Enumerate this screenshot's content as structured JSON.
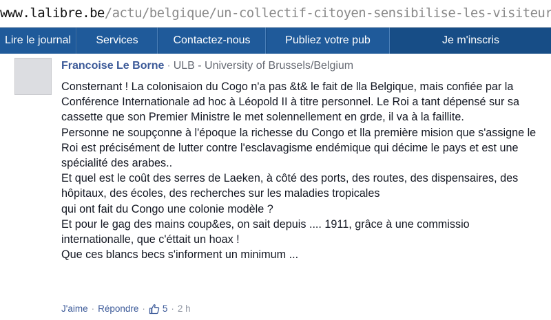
{
  "browser": {
    "url_host": "www.lalibre.be",
    "url_path": "/actu/belgique/un-collectif-citoyen-sensibilise-les-visiteurs-des-serres-royales"
  },
  "navbar": {
    "items": [
      {
        "label": "Lire le journal"
      },
      {
        "label": "Services"
      },
      {
        "label": "Contactez-nous"
      },
      {
        "label": "Publiez votre pub"
      },
      {
        "label": "Je m'inscris"
      }
    ]
  },
  "comment": {
    "author": "Francoise Le Borne",
    "separator": "·",
    "affiliation": "ULB - University of Brussels/Belgium",
    "paragraphs": [
      "Consternant ! La colonisaion du Cogo n'a pas &t& le fait de lla Belgique, mais confiée par la Conférence Internationale ad hoc à Léopold II à titre personnel. Le Roi a tant dépensé sur sa cassette que son Premier Ministre le met solennellement en grde, il va à la faillite.",
      "Personne ne soupçonne à l'époque la richesse du Congo et lla première mision que s'assigne le Roi est précisément de lutter contre l'esclavagisme endémique qui décime le pays et est une spécialité des arabes..",
      "Et quel est le coût des serres de Laeken, à côté des ports, des routes, des dispensaires, des hôpitaux, des écoles, des recherches sur les maladies tropicales",
      "qui ont fait du Congo une colonie modèle ?",
      "Et pour le gag des mains coup&es, on sait depuis .... 1911, grâce à une commissio internationalle, que c'éttait un hoax !",
      "Que ces blancs becs s'informent un minimum ..."
    ],
    "actions": {
      "like_label": "J'aime",
      "reply_label": "Répondre",
      "like_count": "5",
      "timestamp": "2 h"
    }
  },
  "colors": {
    "navbar_bg": "#1f5a9a",
    "author_link": "#3b5998",
    "meta_text": "#9197a3"
  },
  "icons": {
    "like": "thumbs-up-icon",
    "avatar": "default-avatar"
  }
}
